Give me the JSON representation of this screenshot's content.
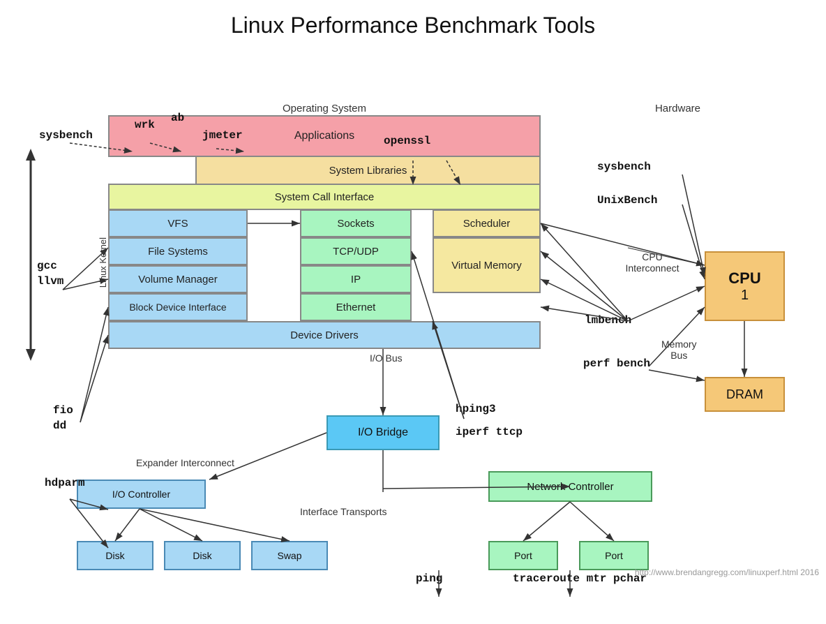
{
  "title": "Linux Performance Benchmark Tools",
  "labels": {
    "os": "Operating System",
    "hardware": "Hardware",
    "linux_kernel": "Linux Kernel",
    "applications": "Applications",
    "system_libraries": "System Libraries",
    "system_call_interface": "System Call Interface",
    "vfs": "VFS",
    "sockets": "Sockets",
    "scheduler": "Scheduler",
    "file_systems": "File Systems",
    "tcpudp": "TCP/UDP",
    "virtual_memory": "Virtual Memory",
    "volume_manager": "Volume Manager",
    "ip": "IP",
    "block_device_interface": "Block Device Interface",
    "ethernet": "Ethernet",
    "device_drivers": "Device Drivers",
    "iobus": "I/O Bus",
    "iobridge": "I/O Bridge",
    "expander_interconnect": "Expander Interconnect",
    "iocontroller": "I/O Controller",
    "disk1": "Disk",
    "disk2": "Disk",
    "swap": "Swap",
    "network_controller": "Network Controller",
    "port1": "Port",
    "port2": "Port",
    "interface_transports": "Interface Transports",
    "cpu": "CPU\n1",
    "cpu_interconnect": "CPU\nInterconnect",
    "memory_bus": "Memory\nBus",
    "dram": "DRAM"
  },
  "tools": {
    "sysbench_left": "sysbench",
    "wrk": "wrk",
    "ab": "ab",
    "jmeter": "jmeter",
    "openssl": "openssl",
    "gcc_llvm": "gcc\nllvm",
    "fio_dd": "fio\ndd",
    "hdparm": "hdparm",
    "sysbench_right": "sysbench",
    "unixbench": "UnixBench",
    "lmbench": "lmbench",
    "perf_bench": "perf bench",
    "hping3": "hping3",
    "iperf_ttcp": "iperf ttcp",
    "ping": "ping",
    "traceroute": "traceroute mtr pchar"
  },
  "url": "http://www.brendangregg.com/linuxperf.html 2016"
}
